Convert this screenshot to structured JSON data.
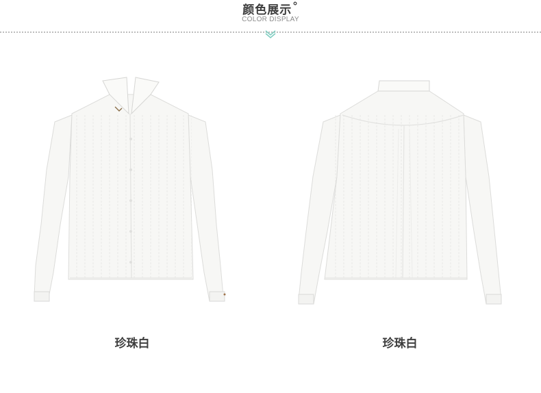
{
  "header": {
    "title": "颜色展示",
    "title_mark": "°",
    "subtitle": "COLOR DISPLAY"
  },
  "products": [
    {
      "view": "front",
      "label": "珍珠白"
    },
    {
      "view": "back",
      "label": "珍珠白"
    }
  ],
  "colors": {
    "title": "#3b3b3b",
    "subtitle": "#8a8a8a",
    "chevron": "#7ecdc0",
    "shirt": "#f7f7f5",
    "shirt_shade": "#e8e8e6"
  }
}
